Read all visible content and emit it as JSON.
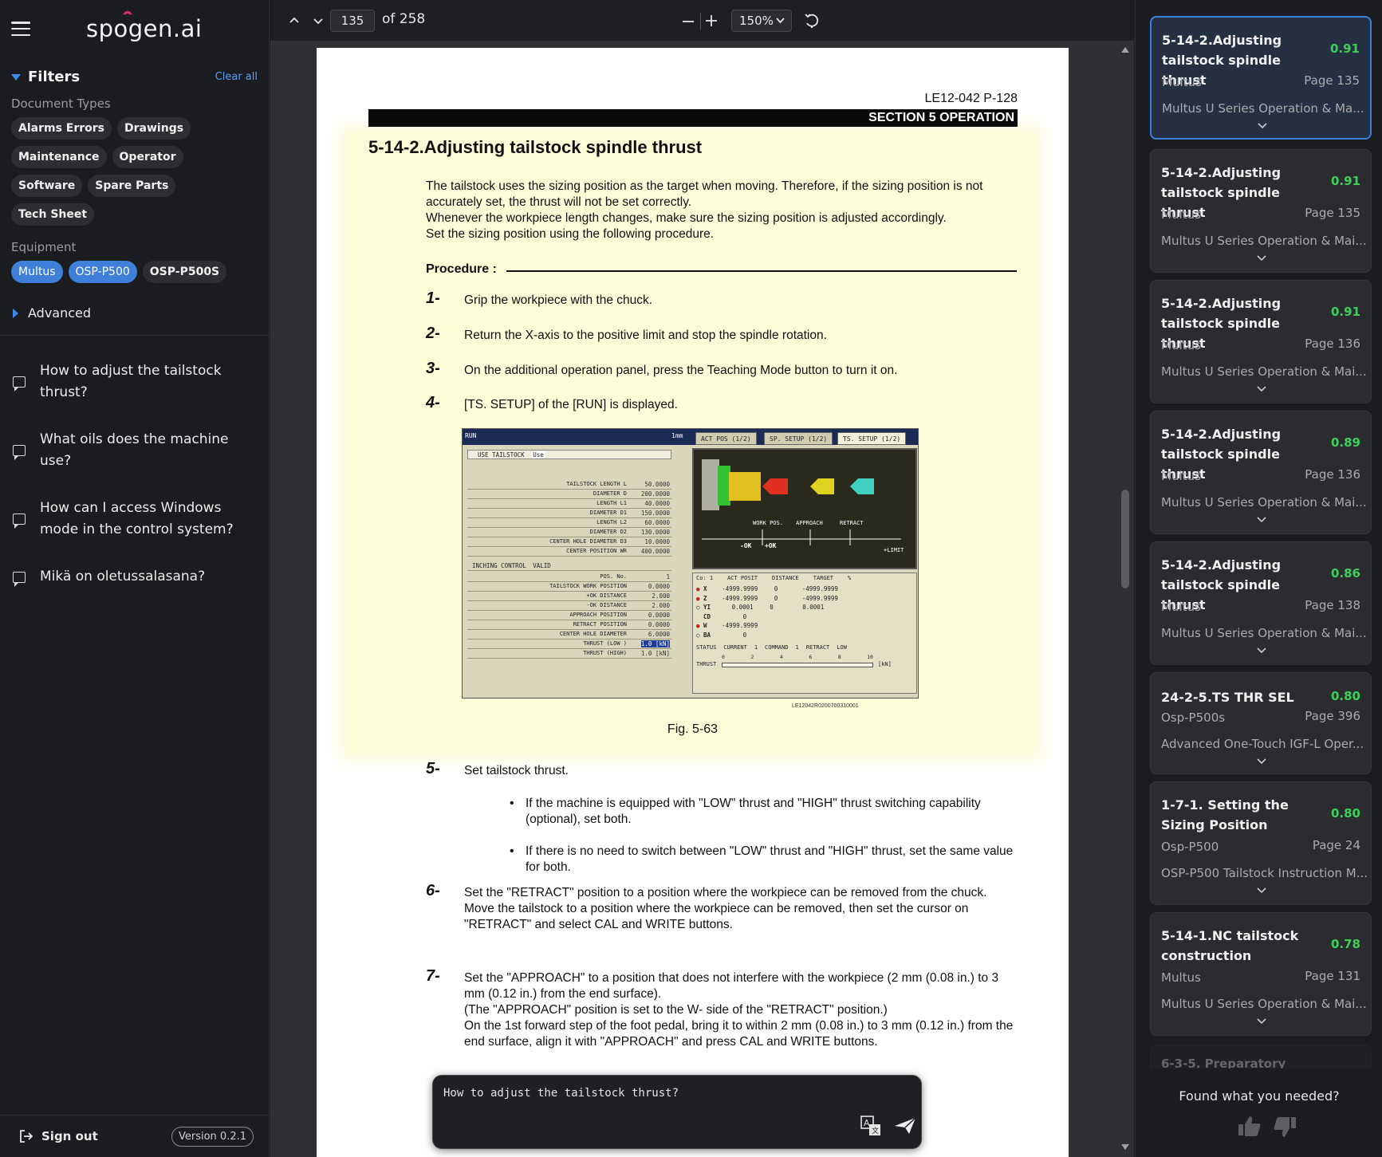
{
  "app": {
    "logo": "spogen.ai",
    "filters": {
      "title": "Filters",
      "clear_all": "Clear all",
      "document_types_label": "Document Types",
      "document_types": [
        "Alarms Errors",
        "Drawings",
        "Maintenance",
        "Operator",
        "Software",
        "Spare Parts",
        "Tech Sheet"
      ],
      "equipment_label": "Equipment",
      "equipment": [
        {
          "label": "Multus",
          "selected": true
        },
        {
          "label": "OSP-P500",
          "selected": true
        },
        {
          "label": "OSP-P500S",
          "selected": false
        }
      ],
      "advanced": "Advanced"
    },
    "history": [
      "How to adjust the tailstock thrust?",
      "What oils does the machine use?",
      "How can I access Windows mode in the control system?",
      "Mikä on oletussalasana?"
    ],
    "sign_out": "Sign out",
    "version": "Version 0.2.1",
    "accent_color": "#3d7fd9"
  },
  "viewer": {
    "page_number": "135",
    "page_total": "of 258",
    "zoom": "150%",
    "doc": {
      "doc_id": "LE12-042 P-128",
      "section": "SECTION 5   OPERATION",
      "title": "5-14-2.Adjusting tailstock spindle thrust",
      "intro": [
        "The tailstock uses the sizing position as the target when moving. Therefore, if the sizing position is not accurately set, the thrust will not be set correctly.",
        "Whenever the workpiece length changes, make sure the sizing position is adjusted accordingly.",
        "Set the sizing position using the following procedure."
      ],
      "procedure_label": "Procedure :",
      "steps": [
        {
          "num": "1-",
          "text": "Grip the workpiece with the chuck."
        },
        {
          "num": "2-",
          "text": "Return the X-axis to the positive limit and stop the spindle rotation."
        },
        {
          "num": "3-",
          "text": "On the additional operation panel, press the Teaching Mode button to turn it on."
        },
        {
          "num": "4-",
          "text": " [TS. SETUP] of the [RUN] is displayed."
        },
        {
          "num": "5-",
          "text": "Set tailstock thrust."
        },
        {
          "num": "6-",
          "text": "Set the \"RETRACT\" position to a position where the workpiece can be removed from the chuck.\nMove the tailstock to a position where the workpiece can be removed, then set the cursor on \"RETRACT\" and select CAL and WRITE buttons."
        },
        {
          "num": "7-",
          "text": "Set the \"APPROACH\" to a position that does not interfere with the workpiece (2 mm (0.08 in.) to 3 mm (0.12 in.) from the end surface).\n(The \"APPROACH\" position is set to the W- side of the \"RETRACT\" position.)\nOn the 1st forward step of the foot pedal, bring it to within 2 mm (0.08 in.) to 3 mm (0.12 in.) from the end surface, align it with \"APPROACH\" and press CAL and WRITE buttons."
        }
      ],
      "bullets": [
        "If the machine is equipped with \"LOW\" thrust and \"HIGH\" thrust switching capability (optional), set both.",
        "If there is no need to switch between \"LOW\" thrust and \"HIGH\" thrust, set the same value for both."
      ],
      "figure_caption": "Fig. 5-63",
      "figure_code": "LE12042R0200700310001",
      "figure": {
        "run": "RUN",
        "unit": "1mm",
        "tabs": [
          "ACT POS (1/2)",
          "SP. SETUP (1/2)",
          "TS. SETUP (1/2)"
        ],
        "use_tailstock": "USE TAILSTOCK",
        "use_value": "Use",
        "rows_top": [
          {
            "label": "TAILSTOCK LENGTH   L",
            "value": "50.0000"
          },
          {
            "label": "DIAMETER D",
            "value": "200.0000"
          },
          {
            "label": "LENGTH   L1",
            "value": "40.0000"
          },
          {
            "label": "DIAMETER D1",
            "value": "150.0000"
          },
          {
            "label": "LENGTH   L2",
            "value": "60.0000"
          },
          {
            "label": "DIAMETER D2",
            "value": "130.0000"
          },
          {
            "label": "CENTER HOLE DIAMETER D3",
            "value": "10.0000"
          },
          {
            "label": "CENTER POSITION WR",
            "value": "400.0000"
          }
        ],
        "inching": "INCHING CONTROL",
        "inching_value": "VALID",
        "rows_bottom": [
          {
            "label": "POS. No.",
            "value": "1"
          },
          {
            "label": "TAILSTOCK WORK POSITION",
            "value": "0.0000"
          },
          {
            "label": "+OK DISTANCE",
            "value": "2.000"
          },
          {
            "label": "-OK DISTANCE",
            "value": "2.000"
          },
          {
            "label": "APPROACH POSITION",
            "value": "0.0000"
          },
          {
            "label": "RETRACT POSITION",
            "value": "0.0000"
          },
          {
            "label": "CENTER HOLE DIAMETER",
            "value": "6.0000"
          },
          {
            "label": "THRUST (LOW )",
            "value": "1.0 [kN]"
          },
          {
            "label": "THRUST (HIGH)",
            "value": "1.0 [kN]"
          }
        ],
        "diagram_labels": [
          "WORK POS.",
          "APPROACH",
          "RETRACT",
          "-OK",
          "+OK",
          "+LIMIT"
        ],
        "status_header": [
          "Co: 1",
          "ACT POSIT",
          "DISTANCE",
          "TARGET",
          "%"
        ],
        "axes": [
          {
            "axis": "X",
            "act": "-4999.9999",
            "dist": "0",
            "target": "-4999.9999"
          },
          {
            "axis": "Z",
            "act": "-4999.9999",
            "dist": "0",
            "target": "-4999.9999"
          },
          {
            "axis": "YI",
            "act": "0.0001",
            "dist": "0",
            "target": "0.0001"
          },
          {
            "axis": "CD",
            "act": "0",
            "dist": "",
            "target": ""
          },
          {
            "axis": "W",
            "act": "-4999.9999",
            "dist": "",
            "target": ""
          },
          {
            "axis": "BA",
            "act": "0",
            "dist": "",
            "target": ""
          }
        ],
        "status_row": [
          "STATUS",
          "CURRENT",
          "1",
          "COMMAND",
          "1",
          "RETRACT",
          "LOW"
        ],
        "thrust_label": "THRUST",
        "thrust_unit": "[kN]",
        "thrust_ticks": [
          "0",
          "2",
          "4",
          "6",
          "8",
          "10"
        ]
      }
    }
  },
  "chat": {
    "input_value": "How to adjust the tailstock thrust?"
  },
  "results": {
    "items": [
      {
        "title": "5-14-2.Adjusting tailstock spindle thrust",
        "score": "0.91",
        "equipment": "Multus",
        "page": "Page 135",
        "source": "Multus U Series Operation & Ma...",
        "active": true
      },
      {
        "title": "5-14-2.Adjusting tailstock spindle thrust",
        "score": "0.91",
        "equipment": "Multus",
        "page": "Page 135",
        "source": "Multus U Series Operation & Mai...",
        "active": false
      },
      {
        "title": "5-14-2.Adjusting tailstock spindle thrust",
        "score": "0.91",
        "equipment": "Multus",
        "page": "Page 136",
        "source": "Multus U Series Operation & Mai...",
        "active": false
      },
      {
        "title": "5-14-2.Adjusting tailstock spindle thrust",
        "score": "0.89",
        "equipment": "Multus",
        "page": "Page 136",
        "source": "Multus U Series Operation & Mai...",
        "active": false
      },
      {
        "title": "5-14-2.Adjusting tailstock spindle thrust",
        "score": "0.86",
        "equipment": "Multus",
        "page": "Page 138",
        "source": "Multus U Series Operation & Mai...",
        "active": false
      },
      {
        "title": "24-2-5.TS THR SEL",
        "score": "0.80",
        "equipment": "Osp-P500s",
        "page": "Page 396",
        "source": "Advanced One-Touch IGF-L Oper...",
        "active": false
      },
      {
        "title": "1-7-1. Setting the Sizing Position",
        "score": "0.80",
        "equipment": "Osp-P500",
        "page": "Page 24",
        "source": "OSP-P500 Tailstock Instruction M...",
        "active": false
      },
      {
        "title": "5-14-1.NC tailstock construction",
        "score": "0.78",
        "equipment": "Multus",
        "page": "Page 131",
        "source": "Multus U Series Operation & Mai...",
        "active": false
      }
    ],
    "partial_title": "6-3-5. Preparatory",
    "feedback_prompt": "Found what you needed?",
    "score_color": "#3ecf5a"
  }
}
